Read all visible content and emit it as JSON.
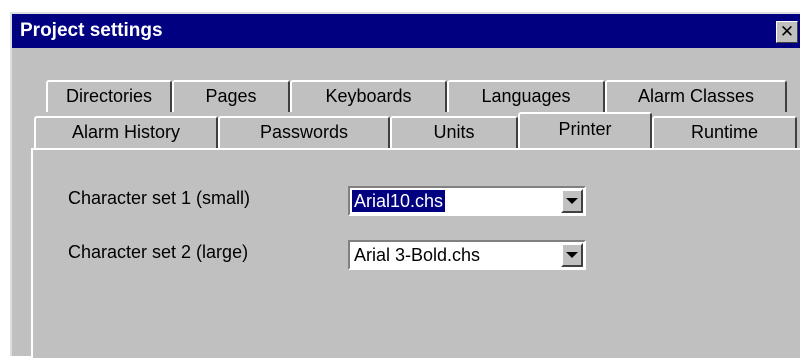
{
  "window": {
    "title": "Project settings",
    "close_glyph": "✕"
  },
  "tabs": {
    "row_back": [
      "Directories",
      "Pages",
      "Keyboards",
      "Languages",
      "Alarm Classes"
    ],
    "row_front": [
      "Alarm History",
      "Passwords",
      "Units",
      "Printer",
      "Runtime"
    ],
    "selected": "Printer"
  },
  "printer": {
    "charset_small_label": "Character set 1 (small)",
    "charset_small_value": "Arial10.chs",
    "charset_large_label": "Character set 2 (large)",
    "charset_large_value": "Arial 3-Bold.chs"
  },
  "colors": {
    "titlebar": "#000080",
    "face": "#c0c0c0",
    "selection": "#000080"
  },
  "icons": [
    "close-icon",
    "dropdown-arrow-icon"
  ]
}
